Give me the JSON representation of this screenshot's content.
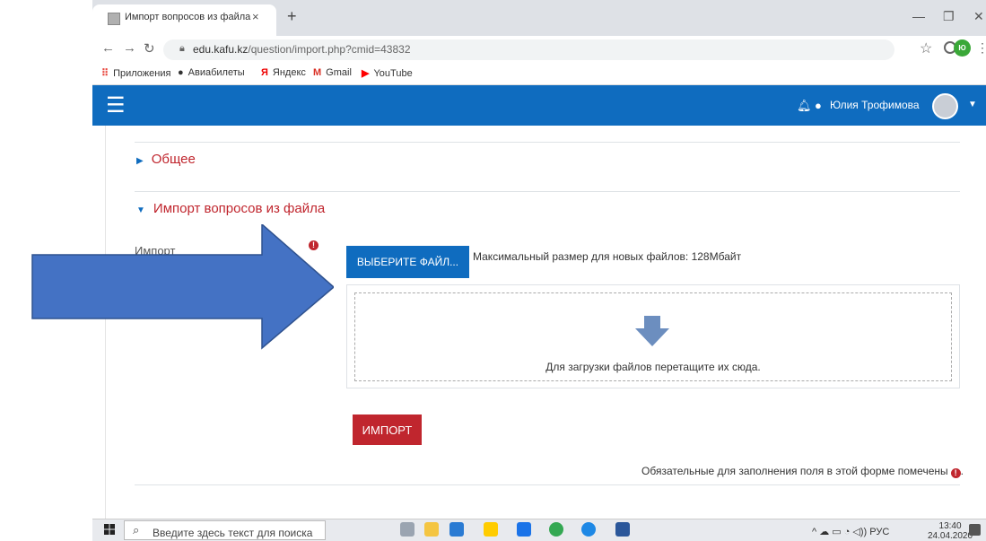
{
  "browser": {
    "tab_title": "Импорт вопросов из файла",
    "tab_close": "×",
    "new_tab": "+",
    "url_host": "edu.kafu.kz",
    "url_path": "/question/import.php?cmid=43832",
    "profile_initials": "Ю",
    "bookmarks": [
      "Приложения",
      "Авиабилеты",
      "Яндекс",
      "Gmail",
      "YouTube"
    ]
  },
  "navbar": {
    "user_name": "Юлия Трофимова",
    "color": "#0f6cbf"
  },
  "form": {
    "section_general": "Общее",
    "section_import": "Импорт вопросов из файла",
    "import_label": "Импорт",
    "required_icon": "!",
    "choose_file_button": "ВЫБЕРИТЕ ФАЙЛ...",
    "max_size_text": "Максимальный размер для новых файлов: 128Мбайт",
    "drop_text": "Для загрузки файлов перетащите их сюда.",
    "import_button": "ИМПОРТ",
    "required_note": "Обязательные для заполнения поля в этой форме помечены",
    "accent_color": "#c0262e"
  },
  "taskbar": {
    "search_placeholder": "Введите здесь текст для поиска",
    "lang": "РУС",
    "time": "13:40",
    "date": "24.04.2020"
  },
  "overlay": {
    "arrow_color": "#4472c4"
  }
}
